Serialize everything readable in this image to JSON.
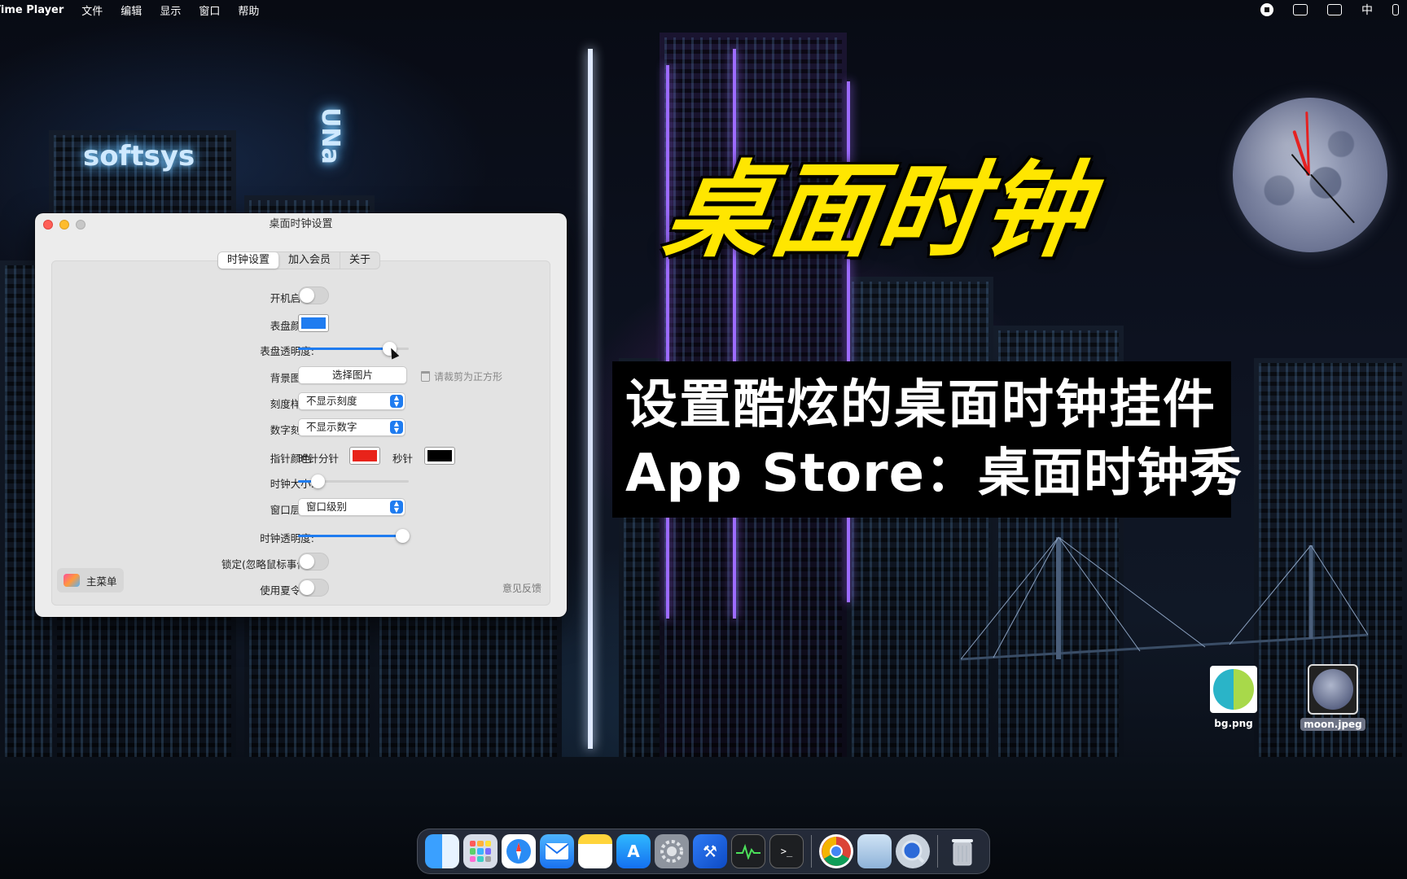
{
  "menubar": {
    "app_name": "Time Player",
    "menus": [
      "文件",
      "编辑",
      "显示",
      "窗口",
      "帮助"
    ],
    "input_method": "中"
  },
  "overlay": {
    "title": "桌面时钟",
    "caption_line1": "设置酷炫的桌面时钟挂件",
    "caption_line2": "App Store：桌面时钟秀"
  },
  "desktop_icons": [
    {
      "label": "bg.png",
      "selected": false
    },
    {
      "label": "moon.jpeg",
      "selected": true
    }
  ],
  "window": {
    "title": "桌面时钟设置",
    "tabs": [
      "时钟设置",
      "加入会员",
      "关于"
    ],
    "active_tab": "时钟设置",
    "rows": {
      "autostart": {
        "label": "开机启动:",
        "value": false
      },
      "dial_color": {
        "label": "表盘颜色:",
        "color": "#1f7cf0"
      },
      "dial_opacity": {
        "label": "表盘透明度:",
        "value": 0.82
      },
      "bg_image": {
        "label": "背景图片:",
        "button": "选择图片",
        "hint": "请裁剪为正方形"
      },
      "tick_style": {
        "label": "刻度样式:",
        "selected": "不显示刻度"
      },
      "number_ticks": {
        "label": "数字刻度:",
        "selected": "不显示数字"
      },
      "hand_color": {
        "label": "指针颜色:",
        "hour_min_label": "时针分针",
        "hour_min_color": "#e8231a",
        "second_label": "秒针",
        "second_color": "#000000"
      },
      "clock_size": {
        "label": "时钟大小:",
        "value": 0.18
      },
      "window_level": {
        "label": "窗口层级:",
        "selected": "窗口级别"
      },
      "clock_opacity": {
        "label": "时钟透明度:",
        "value": 0.94
      },
      "lock": {
        "label": "锁定(忽略鼠标事件):",
        "value": false
      },
      "dst": {
        "label": "使用夏令时:",
        "value": false
      }
    },
    "main_menu": "主菜单",
    "feedback": "意见反馈"
  },
  "dock": {
    "apps": [
      "finder-icon",
      "launchpad-icon",
      "safari-icon",
      "mail-icon",
      "notes-icon",
      "app-store-icon",
      "system-settings-icon",
      "xcode-icon",
      "activity-monitor-icon",
      "terminal-icon",
      "chrome-icon",
      "preview-icon",
      "quicktime-icon",
      "trash-icon"
    ]
  },
  "colors": {
    "title_yellow": "#ffe600",
    "accent_blue": "#1f7cf0"
  }
}
